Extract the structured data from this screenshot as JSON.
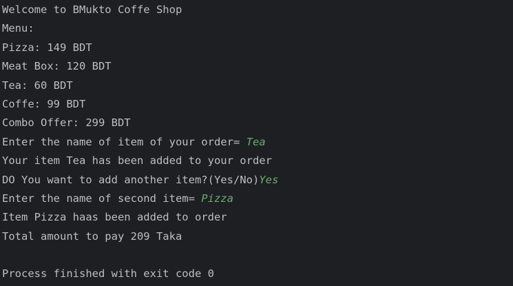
{
  "colors": {
    "background": "#1e1f22",
    "output_text": "#bcbec4",
    "user_input_text": "#6aab73"
  },
  "console": {
    "lines": [
      {
        "text": "Welcome to BMukto Coffe Shop",
        "input": ""
      },
      {
        "text": "Menu:",
        "input": ""
      },
      {
        "text": "Pizza: 149 BDT",
        "input": ""
      },
      {
        "text": "Meat Box: 120 BDT",
        "input": ""
      },
      {
        "text": "Tea: 60 BDT",
        "input": ""
      },
      {
        "text": "Coffe: 99 BDT",
        "input": ""
      },
      {
        "text": "Combo Offer: 299 BDT",
        "input": ""
      },
      {
        "text": "Enter the name of item of your order= ",
        "input": "Tea"
      },
      {
        "text": "Your item Tea has been added to your order",
        "input": ""
      },
      {
        "text": "DO You want to add another item?(Yes/No)",
        "input": "Yes"
      },
      {
        "text": "Enter the name of second item= ",
        "input": "Pizza"
      },
      {
        "text": "Item Pizza haas been added to order",
        "input": ""
      },
      {
        "text": "Total amount to pay 209 Taka",
        "input": ""
      },
      {
        "text": "",
        "input": ""
      },
      {
        "text": "Process finished with exit code 0",
        "input": ""
      }
    ]
  }
}
